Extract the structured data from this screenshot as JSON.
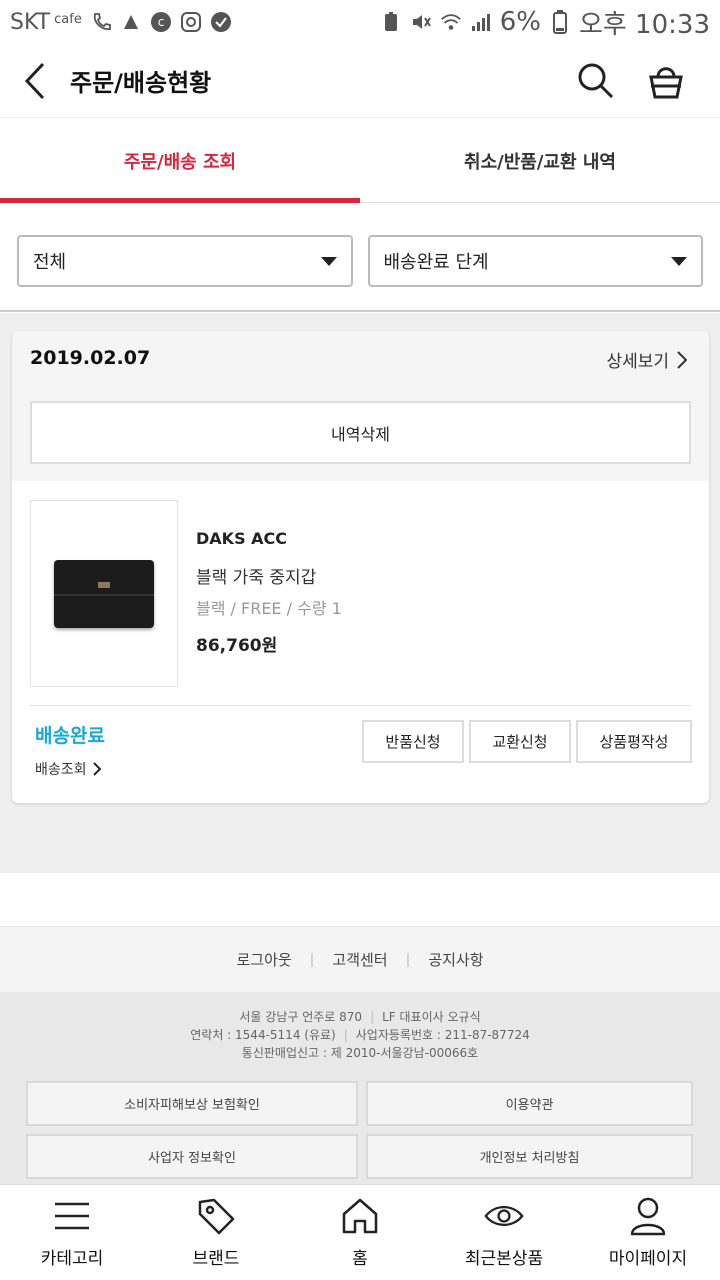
{
  "status_bar": {
    "carrier": "SKT",
    "carrier_badge": "cafe",
    "battery": "6%",
    "time": "오후 10:33"
  },
  "header": {
    "title": "주문/배송현황",
    "icons": [
      "back-icon",
      "search-icon",
      "basket-icon"
    ]
  },
  "tabs": [
    {
      "label": "주문/배송 조회",
      "active": true
    },
    {
      "label": "취소/반품/교환 내역",
      "active": false
    }
  ],
  "filters": {
    "period": "전체",
    "stage": "배송완료 단계"
  },
  "order": {
    "date": "2019.02.07",
    "detail_label": "상세보기",
    "delete_label": "내역삭제",
    "product": {
      "brand": "DAKS ACC",
      "name": "블랙 가죽 중지갑",
      "options": "블랙 / FREE / 수량 1",
      "price": "86,760원"
    },
    "status": "배송완료",
    "tracking_label": "배송조회",
    "actions": [
      "반품신청",
      "교환신청",
      "상품평작성"
    ]
  },
  "footer": {
    "links": [
      "로그아웃",
      "고객센터",
      "공지사항"
    ],
    "info_line1_a": "서울 강남구 언주로 870",
    "info_line1_b": "LF 대표이사 오규식",
    "info_line2_a": "연락처 : 1544-5114 (유료)",
    "info_line2_b": "사업자등록번호 : 211-87-87724",
    "info_line3": "통신판매업신고 : 제 2010-서울강남-00066호",
    "buttons": [
      "소비자피해보상 보험확인",
      "이용약관",
      "사업자 정보확인",
      "개인정보 처리방침"
    ]
  },
  "bottom_nav": [
    {
      "label": "카테고리",
      "icon": "menu-icon"
    },
    {
      "label": "브랜드",
      "icon": "tag-icon"
    },
    {
      "label": "홈",
      "icon": "home-icon"
    },
    {
      "label": "최근본상품",
      "icon": "eye-icon"
    },
    {
      "label": "마이페이지",
      "icon": "person-icon"
    }
  ],
  "colors": {
    "accent": "#d7263d",
    "status_blue": "#1aa6d8"
  }
}
